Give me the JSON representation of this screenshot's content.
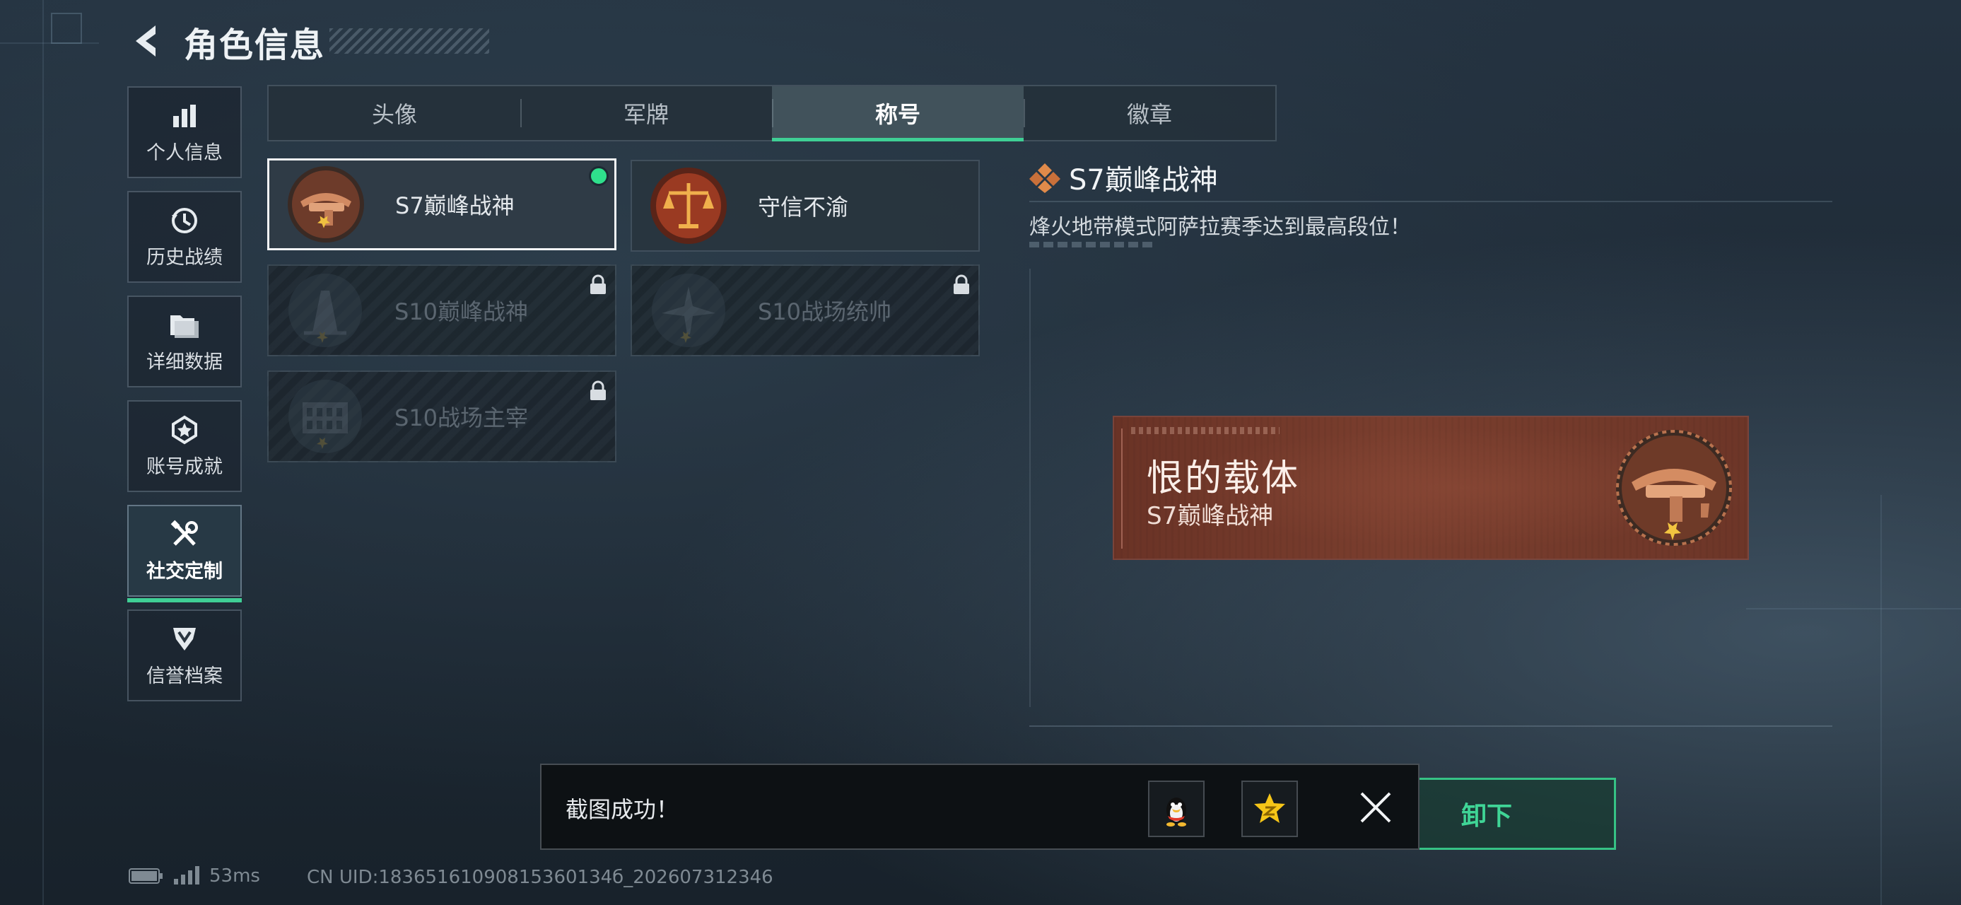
{
  "header": {
    "title": "角色信息"
  },
  "sidebar": {
    "items": [
      {
        "label": "个人信息",
        "icon": "bar-chart-icon",
        "active": false
      },
      {
        "label": "历史战绩",
        "icon": "clock-history-icon",
        "active": false
      },
      {
        "label": "详细数据",
        "icon": "folder-icon",
        "active": false
      },
      {
        "label": "账号成就",
        "icon": "achievement-star-icon",
        "active": false
      },
      {
        "label": "社交定制",
        "icon": "tools-icon",
        "active": true
      },
      {
        "label": "信誉档案",
        "icon": "credit-shield-icon",
        "active": false
      }
    ]
  },
  "tabs": [
    {
      "label": "头像",
      "active": false
    },
    {
      "label": "军牌",
      "active": false
    },
    {
      "label": "称号",
      "active": true
    },
    {
      "label": "徽章",
      "active": false
    }
  ],
  "titles": [
    {
      "label": "S7巅峰战神",
      "state": "selected",
      "equipped": true,
      "icon": "crossbow-emblem-icon"
    },
    {
      "label": "守信不渝",
      "state": "owned",
      "equipped": false,
      "icon": "scales-emblem-icon"
    },
    {
      "label": "S10巅峰战神",
      "state": "locked",
      "equipped": false,
      "icon": "tower-emblem-icon"
    },
    {
      "label": "S10战场统帅",
      "state": "locked",
      "equipped": false,
      "icon": "aircraft-emblem-icon"
    },
    {
      "label": "S10战场主宰",
      "state": "locked",
      "equipped": false,
      "icon": "colosseum-emblem-icon"
    }
  ],
  "detail": {
    "title": "S7巅峰战神",
    "description": "烽火地带模式阿萨拉赛季达到最高段位！",
    "banner": {
      "main_text": "恨的载体",
      "sub_text": "S7巅峰战神"
    },
    "unequip_label": "卸下"
  },
  "toast": {
    "message": "截图成功！",
    "share_qq": "qq-penguin-icon",
    "share_qzone": "qzone-star-icon"
  },
  "status_bar": {
    "latency": "53ms",
    "uid": "CN UID:18365161090815360134б_202607312346"
  },
  "colors": {
    "accent_green": "#3fcf95",
    "banner_red": "#6a3326",
    "bronze": "#b8724e"
  }
}
